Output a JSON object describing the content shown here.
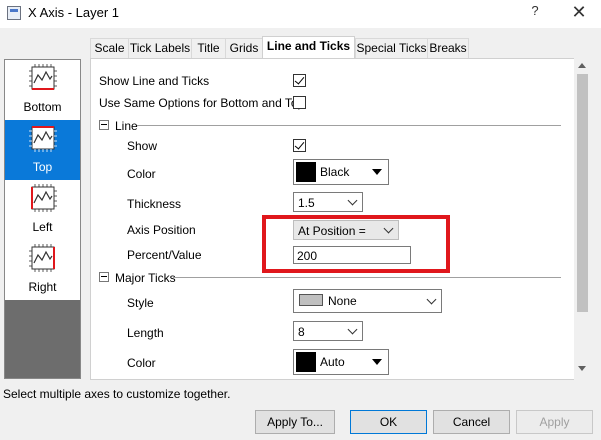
{
  "window": {
    "title": "X Axis - Layer 1",
    "help_label": "?",
    "close_label": "✕"
  },
  "axes": [
    {
      "label": "Bottom",
      "selected": false
    },
    {
      "label": "Top",
      "selected": true
    },
    {
      "label": "Left",
      "selected": false
    },
    {
      "label": "Right",
      "selected": false
    }
  ],
  "tabs": [
    {
      "label": "Scale",
      "active": false
    },
    {
      "label": "Tick Labels",
      "active": false
    },
    {
      "label": "Title",
      "active": false
    },
    {
      "label": "Grids",
      "active": false
    },
    {
      "label": "Line and Ticks",
      "active": true
    },
    {
      "label": "Special Ticks",
      "active": false
    },
    {
      "label": "Breaks",
      "active": false
    }
  ],
  "options": {
    "show_line_ticks_label": "Show Line and Ticks",
    "show_line_ticks_checked": true,
    "same_options_label": "Use Same Options for Bottom and Top",
    "same_options_checked": false
  },
  "line_group": {
    "title": "Line",
    "show_label": "Show",
    "show_checked": true,
    "color_label": "Color",
    "color_value": "Black",
    "color_hex": "#000000",
    "thickness_label": "Thickness",
    "thickness_value": "1.5",
    "axis_position_label": "Axis Position",
    "axis_position_value": "At Position =",
    "percent_label": "Percent/Value",
    "percent_value": "200"
  },
  "major_ticks_group": {
    "title": "Major Ticks",
    "style_label": "Style",
    "style_value": "None",
    "length_label": "Length",
    "length_value": "8",
    "color_label": "Color",
    "color_value": "Auto",
    "color_hex": "#000000"
  },
  "footer": {
    "hint": "Select multiple axes to customize together.",
    "apply_to_label": "Apply To...",
    "ok_label": "OK",
    "cancel_label": "Cancel",
    "apply_label": "Apply"
  },
  "colors": {
    "highlight": "#e0171c",
    "selection": "#0a79d9"
  }
}
